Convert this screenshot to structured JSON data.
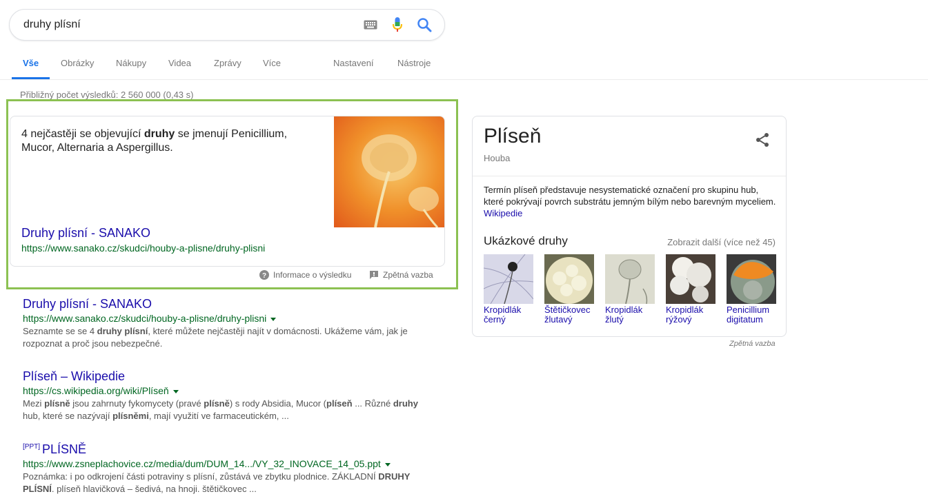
{
  "search": {
    "query": "druhy plísní"
  },
  "tabs": {
    "all": "Vše",
    "images": "Obrázky",
    "shopping": "Nákupy",
    "videos": "Videa",
    "news": "Zprávy",
    "more": "Více",
    "settings": "Nastavení",
    "tools": "Nástroje"
  },
  "stats": "Přibližný počet výsledků: 2 560 000 (0,43 s)",
  "snippet": {
    "text_a": "4 nejčastěji se objevující ",
    "text_bold": "druhy",
    "text_b": " se jmenují Penicillium, Mucor, Alternaria a Aspergillus.",
    "title": "Druhy plísní - SANAKO",
    "url": "https://www.sanako.cz/skudci/houby-a-plisne/druhy-plisni",
    "info_label": "Informace o výsledku",
    "feedback_label": "Zpětná vazba"
  },
  "results": [
    {
      "title": "Druhy plísní - SANAKO",
      "url": "https://www.sanako.cz/skudci/houby-a-plisne/druhy-plisni",
      "desc": [
        {
          "t": "Seznamte se se 4 "
        },
        {
          "t": "druhy plísní",
          "b": true
        },
        {
          "t": ", které můžete nejčastěji najít v domácnosti. Ukážeme vám, jak je rozpoznat a proč jsou nebezpečné."
        }
      ]
    },
    {
      "title": "Plíseň – Wikipedie",
      "url": "https://cs.wikipedia.org/wiki/Plíseň",
      "desc": [
        {
          "t": "Mezi "
        },
        {
          "t": "plísně",
          "b": true
        },
        {
          "t": " jsou zahrnuty fykomycety (pravé "
        },
        {
          "t": "plísně",
          "b": true
        },
        {
          "t": ") s rody Absidia, Mucor ("
        },
        {
          "t": "plíseň",
          "b": true
        },
        {
          "t": " ... Různé "
        },
        {
          "t": "druhy",
          "b": true
        },
        {
          "t": " hub, které se nazývají "
        },
        {
          "t": "plísněmi",
          "b": true
        },
        {
          "t": ", mají využití ve farmaceutickém, ..."
        }
      ]
    },
    {
      "tag": "[PPT]",
      "title": "PLÍSNĚ",
      "url": "https://www.zsneplachovice.cz/media/dum/DUM_14.../VY_32_INOVACE_14_05.ppt",
      "desc": [
        {
          "t": "Poznámka: i po odkrojení části potraviny s plísní, zůstává ve zbytku plodnice. ZÁKLADNÍ "
        },
        {
          "t": "DRUHY PLÍSNÍ",
          "b": true
        },
        {
          "t": ". plíseň hlavičková – šedivá, na hnoji. štětičkovec ..."
        }
      ]
    }
  ],
  "knowledge_panel": {
    "title": "Plíseň",
    "subtitle": "Houba",
    "description": "Termín plíseň představuje nesystematické označení pro skupinu hub, které pokrývají povrch substrátu jemným bílým nebo barevným myceliem.",
    "source": "Wikipedie",
    "examples_title": "Ukázkové druhy",
    "show_more": "Zobrazit další (více než 45)",
    "examples": [
      {
        "label": "Kropidlák černý"
      },
      {
        "label": "Štětičkovec žlutavý"
      },
      {
        "label": "Kropidlák žlutý"
      },
      {
        "label": "Kropidlák rýžový"
      },
      {
        "label": "Penicillium digitatum"
      }
    ],
    "feedback": "Zpětná vazba"
  },
  "colors": {
    "link": "#1a0dab",
    "url": "#006621",
    "accent": "#1a73e8",
    "highlight_border": "#8cc152"
  }
}
